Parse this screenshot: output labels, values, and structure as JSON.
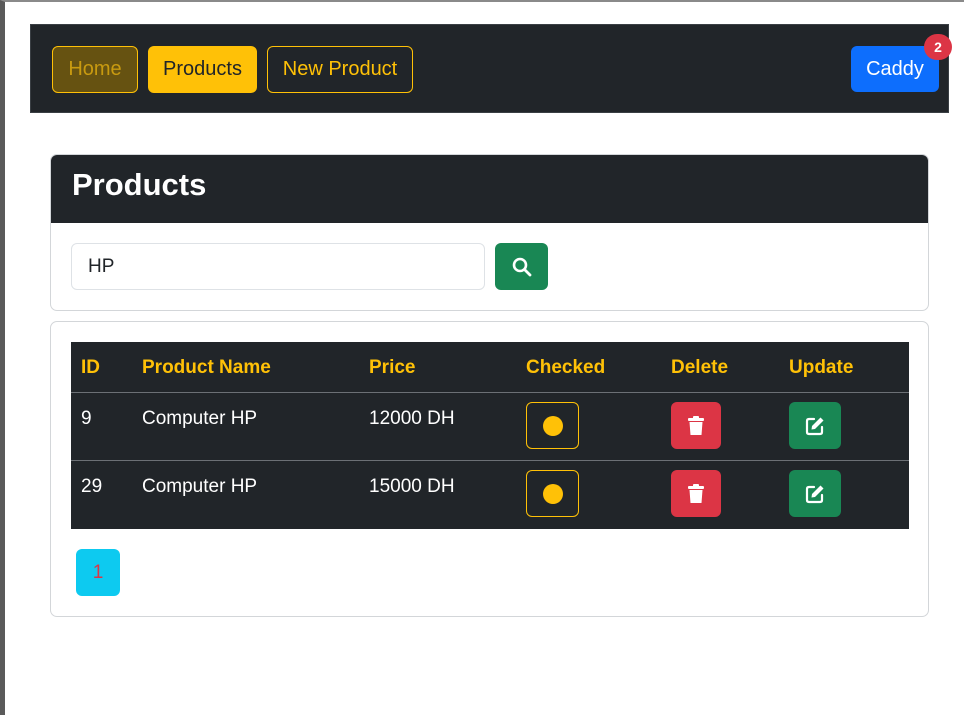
{
  "navbar": {
    "home_label": "Home",
    "products_label": "Products",
    "new_product_label": "New Product",
    "caddy_label": "Caddy",
    "caddy_count": "2"
  },
  "search_card": {
    "title": "Products",
    "search_value": "HP",
    "search_icon": "search-icon"
  },
  "table": {
    "headers": [
      "ID",
      "Product Name",
      "Price",
      "Checked",
      "Delete",
      "Update"
    ],
    "rows": [
      {
        "id": "9",
        "name": "Computer HP",
        "price": "12000 DH",
        "checked": true
      },
      {
        "id": "29",
        "name": "Computer HP",
        "price": "15000 DH",
        "checked": true
      }
    ]
  },
  "pagination": {
    "pages": [
      "1"
    ],
    "current": "1"
  },
  "colors": {
    "dark": "#212529",
    "warning": "#ffc107",
    "primary": "#0d6efd",
    "danger": "#dc3545",
    "success": "#198754",
    "info": "#0dcaf0"
  },
  "icons": {
    "checked": "circle-icon",
    "delete": "trash-icon",
    "update": "edit-icon"
  }
}
